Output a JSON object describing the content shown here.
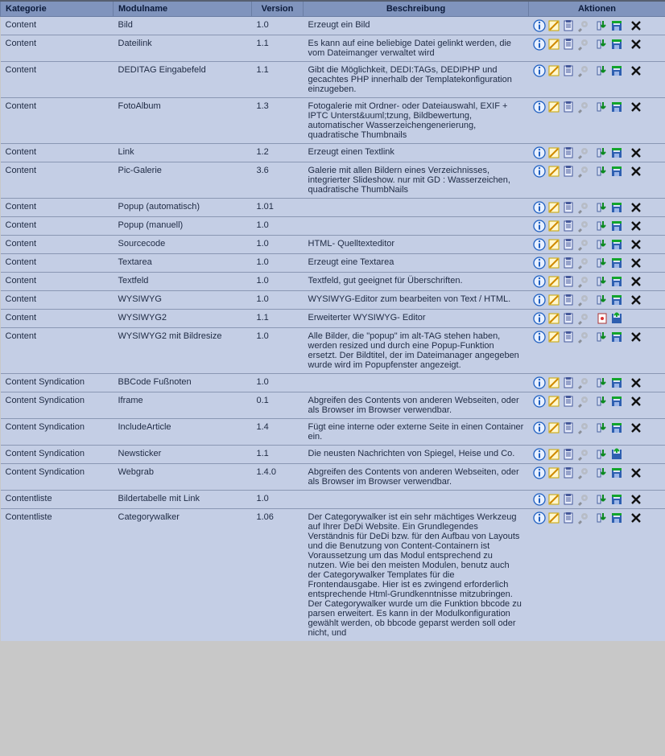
{
  "headers": {
    "category": "Kategorie",
    "module": "Modulname",
    "version": "Version",
    "desc": "Beschreibung",
    "actions": "Aktionen"
  },
  "action_icons": [
    "info",
    "edit",
    "clipboard",
    "wrench",
    "import",
    "save",
    "delete"
  ],
  "rows": [
    {
      "cat": "Content",
      "mod": "Bild",
      "ver": "1.0",
      "desc": "Erzeugt ein Bild",
      "act": "std"
    },
    {
      "cat": "Content",
      "mod": "Dateilink",
      "ver": "1.1",
      "desc": "Es kann auf eine beliebige Datei gelinkt werden, die vom Dateimanger verwaltet wird",
      "act": "std"
    },
    {
      "cat": "Content",
      "mod": "DEDITAG Eingabefeld",
      "ver": "1.1",
      "desc": "Gibt die Möglichkeit, DEDI:TAGs, DEDIPHP und gecachtes PHP innerhalb der Templatekonfiguration einzugeben.",
      "act": "std"
    },
    {
      "cat": "Content",
      "mod": "FotoAlbum",
      "ver": "1.3",
      "desc": "Fotogalerie mit Ordner- oder Dateiauswahl, EXIF + IPTC Unterst&uuml;tzung, Bildbewertung, automatischer Wasserzeichengenerierung, quadratische Thumbnails",
      "act": "std"
    },
    {
      "cat": "Content",
      "mod": "Link",
      "ver": "1.2",
      "desc": "Erzeugt einen Textlink",
      "act": "std"
    },
    {
      "cat": "Content",
      "mod": "Pic-Galerie",
      "ver": "3.6",
      "desc": "Galerie mit allen Bildern eines Verzeichnisses, integrierter Slideshow. nur mit GD : Wasserzeichen, quadratische ThumbNails",
      "act": "std"
    },
    {
      "cat": "Content",
      "mod": "Popup (automatisch)",
      "ver": "1.01",
      "desc": "",
      "act": "std"
    },
    {
      "cat": "Content",
      "mod": "Popup (manuell)",
      "ver": "1.0",
      "desc": "",
      "act": "std"
    },
    {
      "cat": "Content",
      "mod": "Sourcecode",
      "ver": "1.0",
      "desc": "HTML- Quelltexteditor",
      "act": "std"
    },
    {
      "cat": "Content",
      "mod": "Textarea",
      "ver": "1.0",
      "desc": "Erzeugt eine Textarea",
      "act": "std"
    },
    {
      "cat": "Content",
      "mod": "Textfeld",
      "ver": "1.0",
      "desc": "Textfeld, gut geeignet für Überschriften.",
      "act": "std"
    },
    {
      "cat": "Content",
      "mod": "WYSIWYG",
      "ver": "1.0",
      "desc": "WYSIWYG-Editor zum bearbeiten von Text / HTML.",
      "act": "std"
    },
    {
      "cat": "Content",
      "mod": "WYSIWYG2",
      "ver": "1.1",
      "desc": "Erweiterter WYSIWYG- Editor",
      "act": "alt"
    },
    {
      "cat": "Content",
      "mod": "WYSIWYG2 mit Bildresize",
      "ver": "1.0",
      "desc": "Alle Bilder, die \"popup\" im alt-TAG stehen haben, werden resized und durch eine Popup-Funktion ersetzt. Der Bildtitel, der im Dateimanager angegeben wurde wird im Popupfenster angezeigt.",
      "act": "std"
    },
    {
      "cat": "Content Syndication",
      "mod": "BBCode Fußnoten",
      "ver": "1.0",
      "desc": "",
      "act": "std"
    },
    {
      "cat": "Content Syndication",
      "mod": "Iframe",
      "ver": "0.1",
      "desc": "Abgreifen des Contents von anderen Webseiten, oder als Browser im Browser verwendbar.",
      "act": "std"
    },
    {
      "cat": "Content Syndication",
      "mod": "IncludeArticle",
      "ver": "1.4",
      "desc": "Fügt eine interne oder externe Seite in einen Container ein.",
      "act": "std"
    },
    {
      "cat": "Content Syndication",
      "mod": "Newsticker",
      "ver": "1.1",
      "desc": "Die neusten Nachrichten von Spiegel, Heise und Co.",
      "act": "short"
    },
    {
      "cat": "Content Syndication",
      "mod": "Webgrab",
      "ver": "1.4.0",
      "desc": "Abgreifen des Contents von anderen Webseiten, oder als Browser im Browser verwendbar.",
      "act": "std"
    },
    {
      "cat": "Contentliste",
      "mod": "Bildertabelle mit Link",
      "ver": "1.0",
      "desc": "",
      "act": "std"
    },
    {
      "cat": "Contentliste",
      "mod": "Categorywalker",
      "ver": "1.06",
      "desc": "Der Categorywalker ist ein sehr mächtiges Werkzeug auf Ihrer DeDi Website. Ein Grundlegendes Verständnis für DeDi bzw. für den Aufbau von Layouts und die Benutzung von Content-Containern ist Voraussetzung um das Modul entsprechend zu nutzen. Wie bei den meisten Modulen, benutz auch der Categorywalker Templates für die Frontendausgabe. Hier ist es zwingend erforderlich entsprechende Html-Grundkenntnisse mitzubringen. Der Categorywalker wurde um die Funktion bbcode zu parsen erweitert. Es kann in der Modulkonfiguration gewählt werden, ob bbcode geparst werden soll oder nicht, und",
      "act": "std"
    }
  ]
}
